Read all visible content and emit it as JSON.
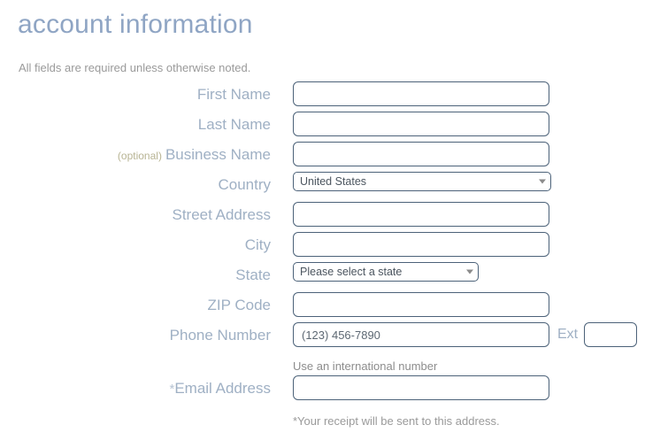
{
  "header": {
    "title": "account information",
    "subtitle": "All fields are required unless otherwise noted."
  },
  "form": {
    "fields": [
      {
        "name": "first-name",
        "label": "First Name",
        "optional_tag": "",
        "type": "text",
        "value": "",
        "placeholder": ""
      },
      {
        "name": "last-name",
        "label": "Last Name",
        "optional_tag": "",
        "type": "text",
        "value": "",
        "placeholder": ""
      },
      {
        "name": "business-name",
        "label": "Business Name",
        "optional_tag": "(optional)",
        "type": "text",
        "value": "",
        "placeholder": ""
      },
      {
        "name": "country",
        "label": "Country",
        "optional_tag": "",
        "type": "select",
        "value": "United States",
        "placeholder": ""
      },
      {
        "name": "street-address",
        "label": "Street Address",
        "optional_tag": "",
        "type": "text",
        "value": "",
        "placeholder": ""
      },
      {
        "name": "city",
        "label": "City",
        "optional_tag": "",
        "type": "text",
        "value": "",
        "placeholder": ""
      },
      {
        "name": "state",
        "label": "State",
        "optional_tag": "",
        "type": "select",
        "value": "Please select a state",
        "placeholder": ""
      },
      {
        "name": "zip-code",
        "label": "ZIP Code",
        "optional_tag": "",
        "type": "text",
        "value": "",
        "placeholder": ""
      }
    ],
    "phone": {
      "label": "Phone Number",
      "placeholder": "(123) 456-7890",
      "value": "",
      "ext_label": "Ext",
      "ext_value": "",
      "ext_placeholder": "",
      "helper_text": "Use an international number"
    },
    "email": {
      "label": "Email Address",
      "required_marker": "*",
      "value": "",
      "placeholder": "",
      "footnote": "*Your receipt will be sent to this address."
    }
  },
  "icons": {
    "dropdown": "chevron-down-icon"
  },
  "colors": {
    "title": "#8fa5c4",
    "label": "#9fb0c4",
    "optional": "#b8b494",
    "input_border": "#4c6279",
    "helper": "#9a9a9a"
  }
}
